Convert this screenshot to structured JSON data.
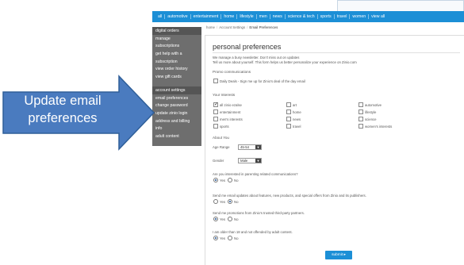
{
  "topnav": {
    "items": [
      "all",
      "automotive",
      "entertainment",
      "home",
      "lifestyle",
      "men",
      "news",
      "science & tech",
      "sports",
      "travel",
      "women",
      "view all"
    ]
  },
  "sidebar": {
    "group1_head": "digital orders",
    "group1_items": [
      "manage",
      "subscriptions",
      "get help with a",
      "subscription",
      "view order history",
      "view gift cards"
    ],
    "group2_head": "account settings",
    "group2_items": [
      "email preferences",
      "change password",
      "update zinio login",
      "address and billing",
      "info",
      "adult content"
    ]
  },
  "breadcrumb": {
    "home": "home",
    "account": "Account Settings",
    "current": "Email Preferences"
  },
  "page": {
    "title": "personal preferences",
    "intro1": "We manage a busy newsletter. Don't miss out on updates",
    "intro2": "Tell us more about yourself. This form helps us better personalize your experience on Zinio.com",
    "promo_section": "Promo communications",
    "promo_daily": "Daily Deals - Sign me up for Zinio's deal of the day email",
    "interests_section": "Your Interests",
    "interests": [
      [
        "all zinio ezalse",
        "art",
        "automotive"
      ],
      [
        "entertainment",
        "home",
        "lifestyle"
      ],
      [
        "men's interests",
        "news",
        "science"
      ],
      [
        "sports",
        "travel",
        "women's interests"
      ]
    ],
    "about_section": "About You",
    "age_label": "Age Range",
    "age_value": "45-54",
    "gender_label": "Gender",
    "gender_value": "Male",
    "q1": "Are you interested in parenting related communications?",
    "q2": "Send me email updates about features, new products, and special offers from Zinio and its publishers.",
    "q3": "Send me promotions from Zinio's trusted third-party partners.",
    "q4": "I am older than 18 and not offended by adult content.",
    "yes": "Yes",
    "no": "No",
    "submit": "submit ▸"
  },
  "annotation": {
    "line1": "Update email",
    "line2": "preferences",
    "color": "#4a7bbf"
  }
}
